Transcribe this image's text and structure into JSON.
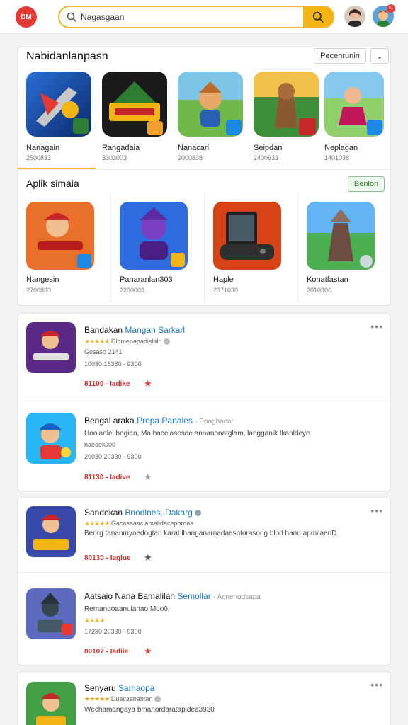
{
  "header": {
    "logo_text": "DM",
    "search_value": "Nagasgaan",
    "avatar_badge": "41"
  },
  "featured": {
    "title": "Nabidanlanpasn",
    "button_label": "Pecenrunin",
    "dropdown_glyph": "⌄",
    "apps": [
      {
        "name": "Nanagain",
        "sub": "2500833"
      },
      {
        "name": "Rangadaia",
        "sub": "3303003"
      },
      {
        "name": "Nanacarl",
        "sub": "2000838"
      },
      {
        "name": "Seipdan",
        "sub": "2400633"
      },
      {
        "name": "Neplagan",
        "sub": "1401038"
      }
    ]
  },
  "similar": {
    "title": "Aplik simaia",
    "button_label": "Benlon",
    "apps": [
      {
        "name": "Nangesin",
        "sub": "2700833"
      },
      {
        "name": "Panaranlan303",
        "sub": "2200003"
      },
      {
        "name": "Haple",
        "sub": "2371038"
      },
      {
        "name": "Konatfastan",
        "sub": "2010306"
      }
    ]
  },
  "feed_group1": [
    {
      "title": "Bandakan",
      "title_link": "Mangan Sarkarl",
      "stars": "★★★★★",
      "line1": "Dlomenapadislaln",
      "line2": "Gosasd 2141",
      "line3": "10030 18330 - 9300",
      "price": "81100 - Iadike",
      "fav": "★",
      "fav_color": "#e53935"
    },
    {
      "title": "Bengal araka",
      "title_link": "Prepa Panales",
      "title_muted": "- Poaghacnr",
      "line1": "Hoolanlel hegian, Ma bacelasesde annanonatglam, langganik Ikanldeye",
      "line2": "haeaelO00",
      "line3": "20030 20330 - 9300",
      "price": "81130 - Iadive",
      "fav": "★",
      "fav_color": "#9e9e9e"
    }
  ],
  "feed_group2": [
    {
      "title": "Sandekan",
      "title_link": "Bnodlnes, Dakarg",
      "stars": "★★★★★",
      "line1": "Gacaseaaclamalidaceporoes",
      "line2": "Bedrg tananmyaedogtan karat lhanganarnadaesntorasong blod hand apmilaenD",
      "price": "80130 - Iaglue",
      "fav": "★",
      "fav_color": "#555555"
    },
    {
      "title": "Aatsaio Nana Bamalilan",
      "title_link": "Semollar",
      "title_muted": "- Acnenodsapa",
      "line1": "Remangoaanulanao Moo0.",
      "stars": "★★★★",
      "line2": "17280 20330 - 9300",
      "price": "80107 - Iadiie",
      "fav": "★",
      "fav_color": "#e53935"
    }
  ],
  "feed_group3": [
    {
      "title": "Senyaru",
      "title_link": "Samaopa",
      "stars": "★★★★★",
      "line1": "Duacaenabtan",
      "line2": "Wechamangaya bmanordaratapidea3930"
    }
  ],
  "colors": {
    "accent": "#f5b416",
    "brand_red": "#e53935",
    "link_blue": "#1976d2",
    "price_red": "#d32f2f"
  }
}
